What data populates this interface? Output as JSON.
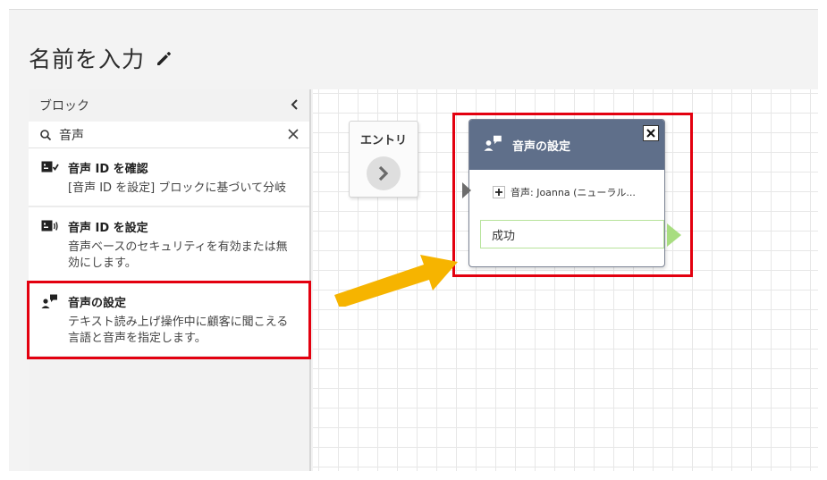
{
  "page": {
    "title": "名前を入力"
  },
  "sidebar": {
    "header": "ブロック",
    "search": {
      "value": "音声",
      "placeholder": ""
    },
    "items": [
      {
        "name": "音声 ID を確認",
        "description": "[音声 ID を設定] ブロックに基づいて分岐",
        "icon": "voice-id-check-icon"
      },
      {
        "name": "音声 ID を設定",
        "description": "音声ベースのセキュリティを有効または無効にします。",
        "icon": "voice-id-set-icon"
      },
      {
        "name": "音声の設定",
        "description": "テキスト読み上げ操作中に顧客に聞こえる言語と音声を指定します。",
        "icon": "set-voice-icon",
        "selected": true
      }
    ]
  },
  "canvas": {
    "entry": {
      "label": "エントリ"
    },
    "node": {
      "title": "音声の設定",
      "param": "音声: Joanna (ニューラル...",
      "branch": "成功"
    }
  },
  "colors": {
    "highlight": "#e3000f",
    "node_header": "#5f6f8a",
    "success_port": "#a8dd80",
    "arrow": "#f6b400"
  }
}
